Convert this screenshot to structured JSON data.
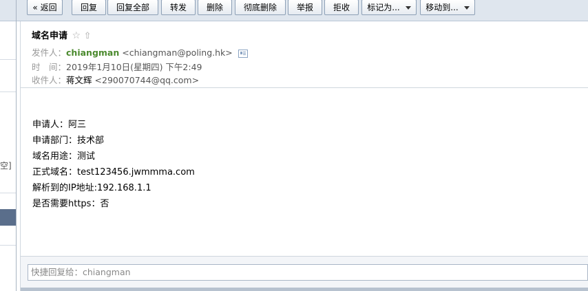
{
  "toolbar": {
    "back": "« 返回",
    "reply": "回复",
    "reply_all": "回复全部",
    "forward": "转发",
    "delete": "删除",
    "delete_permanent": "彻底删除",
    "report": "举报",
    "reject": "拒收",
    "mark_as": "标记为...",
    "move_to": "移动到..."
  },
  "left_panel": {
    "partial_text": "空]"
  },
  "email": {
    "subject": "域名申请",
    "star_glyph": "☆",
    "up_glyph": "⇧",
    "from_label": "发件人：",
    "from_name": "chiangman",
    "from_addr": "<chiangman@poling.hk>",
    "time_label": "时　间：",
    "time_value": "2019年1月10日(星期四) 下午2:49",
    "to_label": "收件人：",
    "to_name": "蒋文辉",
    "to_addr": "<290070744@qq.com>"
  },
  "body_lines": [
    "申请人：阿三",
    "申请部门：技术部",
    "域名用途：测试",
    "正式域名：test123456.jwmmma.com",
    "解析到的IP地址:192.168.1.1",
    "是否需要https：否"
  ],
  "quick_reply": {
    "placeholder": "快捷回复给：chiangman"
  }
}
